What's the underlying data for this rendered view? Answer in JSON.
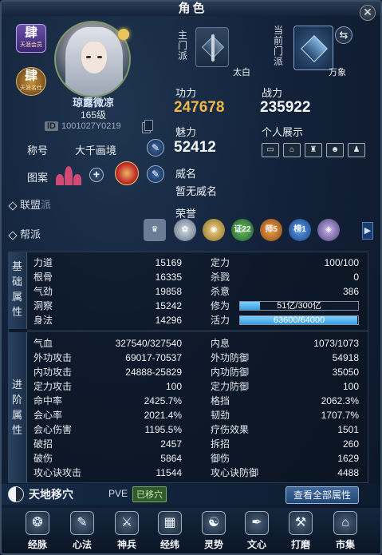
{
  "window": {
    "title": "角色",
    "close_glyph": "✕"
  },
  "badges": {
    "badge1_main": "肆",
    "badge1_sub": "天涯会员",
    "badge2_main": "肆",
    "badge2_sub": "天涯名仕"
  },
  "profile": {
    "name": "琼露微凉",
    "level": "165级",
    "id_tag": "ID",
    "id_value": "1001027Y0219"
  },
  "left": {
    "title_label": "称号",
    "title_value": "大千画境",
    "totem_label": "图案",
    "alliance_label": "联盟",
    "alliance_value": "派",
    "faction_label": "帮派"
  },
  "sect": {
    "main_label": "主门派",
    "main_name": "太白",
    "current_label": "当前门派",
    "current_name": "万象",
    "swap_glyph": "⇆"
  },
  "stats_top": {
    "gongli_label": "功力",
    "gongli_value": "247678",
    "zhanli_label": "战力",
    "zhanli_value": "235922",
    "meili_label": "魅力",
    "meili_value": "52412",
    "show_label": "个人展示",
    "weiming_label": "威名",
    "weiming_value": "暂无威名",
    "rongyu_label": "荣誉"
  },
  "show_icons": [
    "id-card-icon",
    "house-icon",
    "castle-icon",
    "mask-icon",
    "figure-icon"
  ],
  "honors": [
    {
      "icon": "crown-icon",
      "text": ""
    },
    {
      "icon": "lotus-icon",
      "text": ""
    },
    {
      "icon": "ring-icon",
      "text": ""
    },
    {
      "icon": "zheng-icon",
      "text": "证22"
    },
    {
      "icon": "shi-icon",
      "text": "师5"
    },
    {
      "icon": "bang-icon",
      "text": "榜1"
    },
    {
      "icon": "gem-icon",
      "text": ""
    }
  ],
  "basic_label": "基础属性",
  "basic_left": [
    {
      "name": "力道",
      "value": "15169"
    },
    {
      "name": "根骨",
      "value": "16335"
    },
    {
      "name": "气劲",
      "value": "19858"
    },
    {
      "name": "洞察",
      "value": "15242"
    },
    {
      "name": "身法",
      "value": "14296"
    }
  ],
  "basic_right": [
    {
      "name": "定力",
      "value": "100/100"
    },
    {
      "name": "杀戮",
      "value": "0"
    },
    {
      "name": "杀意",
      "value": "386"
    }
  ],
  "xiuwei": {
    "name": "修为",
    "text": "51亿/300亿",
    "fraction": 0.17
  },
  "huoli": {
    "name": "活力",
    "text": "63600/64000",
    "fraction": 0.994
  },
  "adv_label": "进阶属性",
  "adv_left": [
    {
      "name": "气血",
      "value": "327540/327540"
    },
    {
      "name": "外功攻击",
      "value": "69017-70537"
    },
    {
      "name": "内功攻击",
      "value": "24888-25829"
    },
    {
      "name": "定力攻击",
      "value": "100"
    },
    {
      "name": "命中率",
      "value": "2425.7%"
    },
    {
      "name": "会心率",
      "value": "2021.4%"
    },
    {
      "name": "会心伤害",
      "value": "1195.5%"
    },
    {
      "name": "破招",
      "value": "2457"
    },
    {
      "name": "破伤",
      "value": "5864"
    },
    {
      "name": "攻心诀攻击",
      "value": "11544"
    }
  ],
  "adv_right": [
    {
      "name": "内息",
      "value": "1073/1073"
    },
    {
      "name": "外功防御",
      "value": "54918"
    },
    {
      "name": "内功防御",
      "value": "35050"
    },
    {
      "name": "定力防御",
      "value": "100"
    },
    {
      "name": "格挡",
      "value": "2062.3%"
    },
    {
      "name": "韧劲",
      "value": "1707.7%"
    },
    {
      "name": "疗伤效果",
      "value": "1501"
    },
    {
      "name": "拆招",
      "value": "260"
    },
    {
      "name": "御伤",
      "value": "1629"
    },
    {
      "name": "攻心诀防御",
      "value": "4488"
    }
  ],
  "footer": {
    "tiandi": "天地移穴",
    "pve": "PVE",
    "moved": "已移穴",
    "view_all": "查看全部属性"
  },
  "nav": [
    {
      "label": "经脉",
      "icon": "meridian-icon",
      "glyph": "❂"
    },
    {
      "label": "心法",
      "icon": "scroll-icon",
      "glyph": "✎"
    },
    {
      "label": "神兵",
      "icon": "weapon-icon",
      "glyph": "⚔"
    },
    {
      "label": "经纬",
      "icon": "grid-icon",
      "glyph": "▦"
    },
    {
      "label": "灵势",
      "icon": "spirit-icon",
      "glyph": "☯"
    },
    {
      "label": "文心",
      "icon": "brush-icon",
      "glyph": "✒"
    },
    {
      "label": "打磨",
      "icon": "hammer-icon",
      "glyph": "⚒"
    },
    {
      "label": "市集",
      "icon": "market-icon",
      "glyph": "⌂"
    }
  ]
}
